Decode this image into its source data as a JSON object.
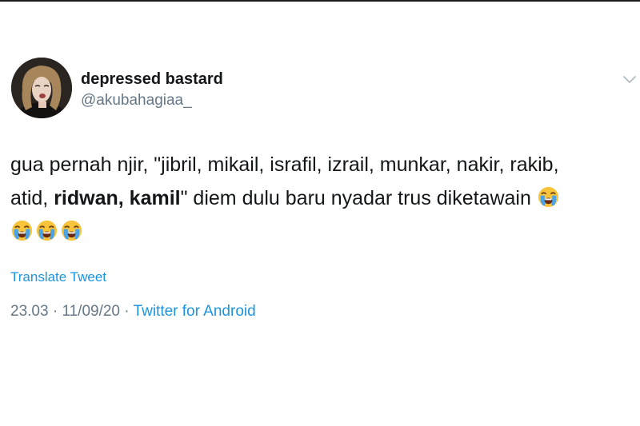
{
  "tweet": {
    "user": {
      "display_name": "depressed bastard",
      "handle": "@akubahagiaa_",
      "avatar_icon": "profile-photo"
    },
    "text": {
      "line1": "gua pernah njir, \"jibril, mikail, israfil, izrail, munkar, nakir, rakib,",
      "line2_start": "atid, ",
      "line2_bold1": "ridwan,",
      "line2_space": " ",
      "line2_bold2": "kamil",
      "line2_end": "\" diem dulu baru nyadar trus diketawain ",
      "emoji_name": "loudly-crying-face"
    },
    "translate_label": "Translate Tweet",
    "time": "23.03",
    "date": "11/09/20",
    "separator": " · ",
    "source": "Twitter for Android",
    "colors": {
      "link": "#1b95e0",
      "muted": "#657786",
      "text": "#14171a"
    }
  }
}
